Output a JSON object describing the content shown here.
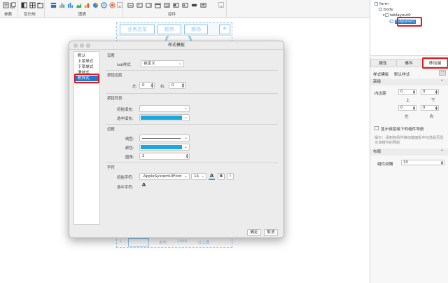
{
  "toolbar": {
    "sections": [
      {
        "label": "参数"
      },
      {
        "label": "空白块"
      },
      {
        "label": "图表"
      },
      {
        "label": "控件"
      }
    ]
  },
  "canvas": {
    "mobile_tabs": [
      "业务总览",
      "超市",
      "商场"
    ],
    "grid_row": {
      "index": "1",
      "cells": [
        "本地",
        "2568",
        "比上周"
      ]
    }
  },
  "tree": {
    "nodes": [
      "form",
      "body",
      "tablayout0",
      "tabpanel1"
    ]
  },
  "right_tabs": [
    "属性",
    "事件",
    "移动端"
  ],
  "props": {
    "style_template_label": "样式模板",
    "style_template_value": "默认样式",
    "sect_advanced": "高级",
    "padding_label": "内边距",
    "top_value": "0",
    "top_label": "上",
    "right_value": "0",
    "right_label": "下",
    "left_value": "0",
    "bottom_value": "0",
    "left_label": "左",
    "right2_label": "右",
    "nav_checkbox_label": "显示该层级下的组件导航",
    "nav_hint": "提示：请到各组件移动端面板中勾选是否显示该组件的导航",
    "sect_layout": "布局",
    "gap_label": "组件间隔",
    "gap_value": "10"
  },
  "modal": {
    "title": "样式模板",
    "list": [
      "默认",
      "上菜单式",
      "下菜单式",
      "滑块式",
      "默样式"
    ],
    "selected_index": 4,
    "section_settings": "设置",
    "tab_style_label": "tab样式",
    "tab_style_value": "自定义",
    "section_btn_margin": "按钮边距",
    "left_label": "左:",
    "left_value": "0",
    "right_label": "右:",
    "right_value": "0",
    "section_btn_bg": "按钮背景",
    "init_fill_label": "初始填充:",
    "sel_fill_label": "选中填充:",
    "sel_fill_color": "#1aa8e0",
    "section_border": "边框",
    "line_type_label": "线型:",
    "color_label": "颜色:",
    "border_color": "#1aa8e0",
    "radius_label": "圆角:",
    "radius_value": "2",
    "section_font": "字符",
    "init_font_label": "初始字符:",
    "font_name": ".AppleSystemUIFont",
    "font_size": "14",
    "bold": "B",
    "italic": "I",
    "font_color_glyph": "A",
    "sel_font_label": "选中字符:",
    "ok": "确定",
    "cancel": "取消"
  },
  "accent": "#1f78d1",
  "highlight_color": "#e0191c"
}
